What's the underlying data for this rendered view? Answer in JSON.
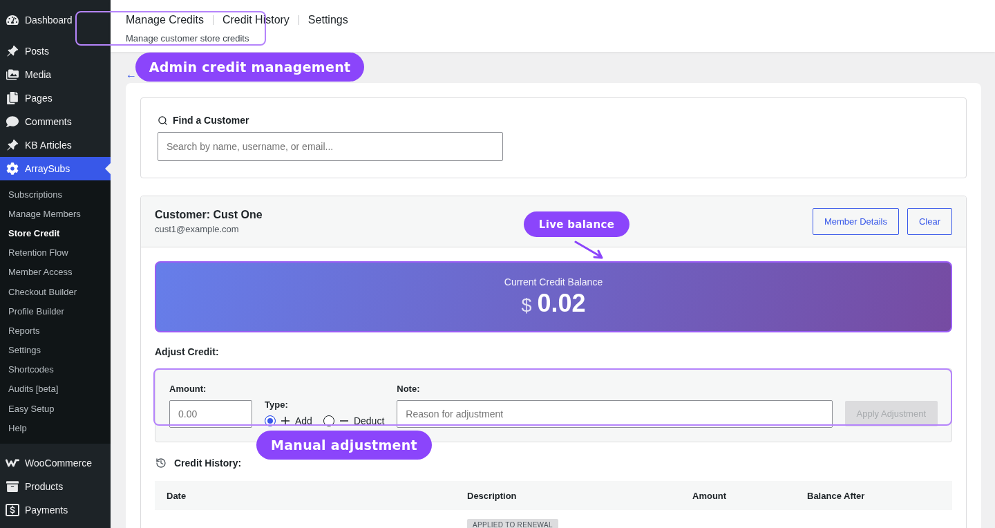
{
  "sidebar": {
    "groups": [
      {
        "items": [
          {
            "label": "Dashboard",
            "selected": false
          }
        ]
      },
      {
        "items": [
          {
            "label": "Posts",
            "selected": false
          },
          {
            "label": "Media",
            "selected": false
          },
          {
            "label": "Pages",
            "selected": false
          },
          {
            "label": "Comments",
            "selected": false
          },
          {
            "label": "KB Articles",
            "selected": false
          },
          {
            "label": "ArraySubs",
            "selected": true,
            "children": [
              {
                "label": "Subscriptions",
                "selected": false
              },
              {
                "label": "Manage Members",
                "selected": false
              },
              {
                "label": "Store Credit",
                "selected": true
              },
              {
                "label": "Retention Flow",
                "selected": false
              },
              {
                "label": "Member Access",
                "selected": false
              },
              {
                "label": "Checkout Builder",
                "selected": false
              },
              {
                "label": "Profile Builder",
                "selected": false
              },
              {
                "label": "Reports",
                "selected": false
              },
              {
                "label": "Settings",
                "selected": false
              },
              {
                "label": "Shortcodes",
                "selected": false
              },
              {
                "label": "Audits [beta]",
                "selected": false
              },
              {
                "label": "Easy Setup",
                "selected": false
              },
              {
                "label": "Help",
                "selected": false
              }
            ]
          }
        ]
      },
      {
        "items": [
          {
            "label": "WooCommerce",
            "selected": false
          },
          {
            "label": "Products",
            "selected": false
          },
          {
            "label": "Payments",
            "selected": false
          }
        ]
      }
    ]
  },
  "header": {
    "links": [
      "Manage Credits",
      "Credit History",
      "Settings"
    ],
    "subtitle": "Manage customer store credits"
  },
  "back_link": "←",
  "find_customer": {
    "label": "Find a Customer",
    "placeholder": "Search by name, username, or email..."
  },
  "customer": {
    "name": "Customer: Cust One",
    "email": "cust1@example.com",
    "buttons": [
      "Member Details",
      "Clear"
    ]
  },
  "balance": {
    "label": "Current Credit Balance",
    "currency": "$",
    "amount": "0.02"
  },
  "adjust": {
    "title": "Adjust Credit:",
    "amount": {
      "label": "Amount:",
      "placeholder": "0.00"
    },
    "type": {
      "label": "Type:",
      "options": [
        {
          "label": "Add",
          "selected": true
        },
        {
          "label": "Deduct",
          "selected": false
        }
      ]
    },
    "note": {
      "label": "Note:",
      "placeholder": "Reason for adjustment"
    },
    "button": {
      "label": "Apply Adjustment",
      "disabled": true
    }
  },
  "history": {
    "title": "Credit History:",
    "columns": [
      "Date",
      "Description",
      "Amount",
      "Balance After"
    ],
    "rows": [
      {
        "description_badge": "APPLIED TO RENEWAL"
      }
    ]
  },
  "annotations": {
    "labels": [
      "Admin credit management",
      "Live balance",
      "Manual adjustment"
    ]
  }
}
